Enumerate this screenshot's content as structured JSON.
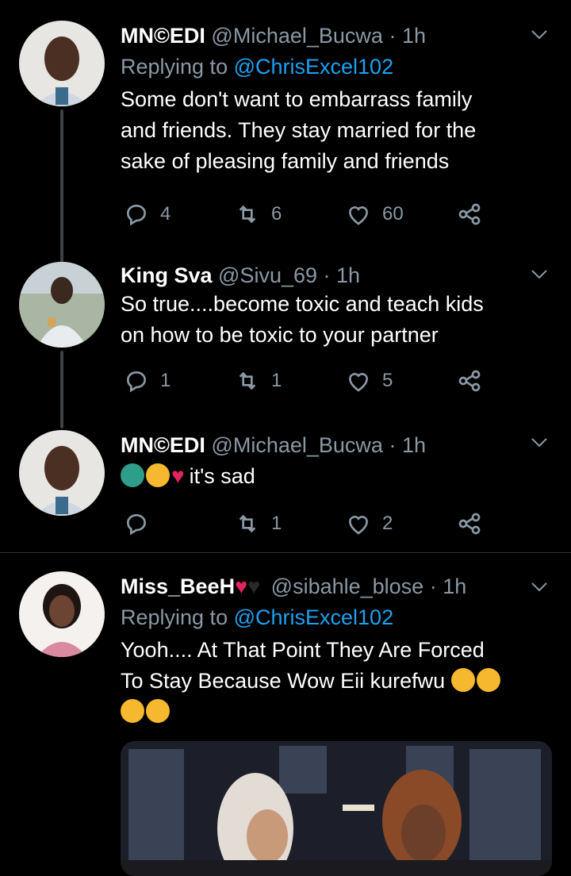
{
  "tweets": [
    {
      "name": "MN©EDI",
      "handle": "@Michael_Bucwa",
      "time": "· 1h",
      "replying_to_prefix": "Replying to ",
      "replying_to": "@ChrisExcel102",
      "lines": [
        "Some don't want to embarrass family",
        "and friends. They stay married for the",
        "sake of pleasing family and friends"
      ],
      "replies": "4",
      "retweets": "6",
      "likes": "60"
    },
    {
      "name": "King Sva",
      "handle": "@Sivu_69",
      "time": "· 1h",
      "lines": [
        "So true....become toxic and teach kids",
        "on how to be toxic to your partner"
      ],
      "replies": "1",
      "retweets": "1",
      "likes": "5"
    },
    {
      "name": "MN©EDI",
      "handle": "@Michael_Bucwa",
      "time": "· 1h",
      "text": "it's sad",
      "emojis": [
        "woman-gesturing-no",
        "crying-face",
        "broken-heart"
      ],
      "replies": "",
      "retweets": "1",
      "likes": "2"
    },
    {
      "name": "Miss_BeeH",
      "name_emojis": [
        "red-heart",
        "black-heart"
      ],
      "handle": "@sibahle_blose",
      "time": "· 1h",
      "replying_to_prefix": "Replying to ",
      "replying_to": "@ChrisExcel102",
      "lines": [
        "Yooh.... At That Point They Are Forced",
        "To Stay Because Wow Eii kurefwu"
      ],
      "trailing_emojis": [
        "face-with-tears-of-joy",
        "face-with-tears-of-joy",
        "face-with-tears-of-joy",
        "face-with-tears-of-joy"
      ]
    }
  ],
  "colors": {
    "background": "#000000",
    "text": "#ffffff",
    "secondary": "#8b98a5",
    "link": "#1da1f2",
    "divider": "#2f3336"
  }
}
